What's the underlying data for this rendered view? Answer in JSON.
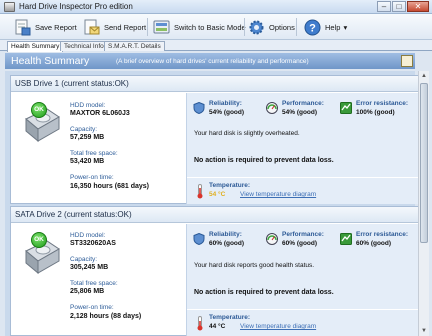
{
  "window": {
    "title": "Hard Drive Inspector Pro edition",
    "minimize": "–",
    "maximize": "□",
    "close": "✕"
  },
  "toolbar": {
    "save_report": "Save Report",
    "send_report": "Send Report",
    "switch_mode": "Switch to Basic Mode",
    "options": "Options",
    "help": "Help",
    "help_arrow": "▾"
  },
  "tabs": [
    "Health Summary",
    "Technical Info",
    "S.M.A.R.T. Details"
  ],
  "banner": {
    "title": "Health Summary",
    "subtitle": "(A brief overview of hard drives' current reliability and performance)"
  },
  "drives": [
    {
      "header": "USB Drive 1 (current status:OK)",
      "badge": "OK",
      "model_label": "HDD model:",
      "model": "MAXTOR 6L060J3",
      "capacity_label": "Capacity:",
      "capacity": "57,259 MB",
      "free_label": "Total free space:",
      "free": "53,420 MB",
      "power_label": "Power-on time:",
      "power": "16,350 hours (681 days)",
      "reliability_label": "Reliability:",
      "reliability": "54% (good)",
      "performance_label": "Performance:",
      "performance": "54% (good)",
      "error_label": "Error resistance:",
      "error": "100% (good)",
      "message": "Your hard disk is slightly overheated.",
      "action": "No action is required to prevent data loss.",
      "temp_label": "Temperature:",
      "temp": "54 °C",
      "temp_color": "#e0b020",
      "link": "View temperature diagram"
    },
    {
      "header": "SATA Drive 2 (current status:OK)",
      "badge": "OK",
      "model_label": "HDD model:",
      "model": "ST3320620AS",
      "capacity_label": "Capacity:",
      "capacity": "305,245 MB",
      "free_label": "Total free space:",
      "free": "25,806 MB",
      "power_label": "Power-on time:",
      "power": "2,128 hours (88 days)",
      "reliability_label": "Reliability:",
      "reliability": "60% (good)",
      "performance_label": "Performance:",
      "performance": "60% (good)",
      "error_label": "Error resistance:",
      "error": "60% (good)",
      "message": "Your hard disk reports good health status.",
      "action": "No action is required to prevent data loss.",
      "temp_label": "Temperature:",
      "temp": "44 °C",
      "temp_color": "#111111",
      "link": "View temperature diagram"
    }
  ],
  "scrollbar": {
    "up": "▲",
    "down": "▼"
  }
}
